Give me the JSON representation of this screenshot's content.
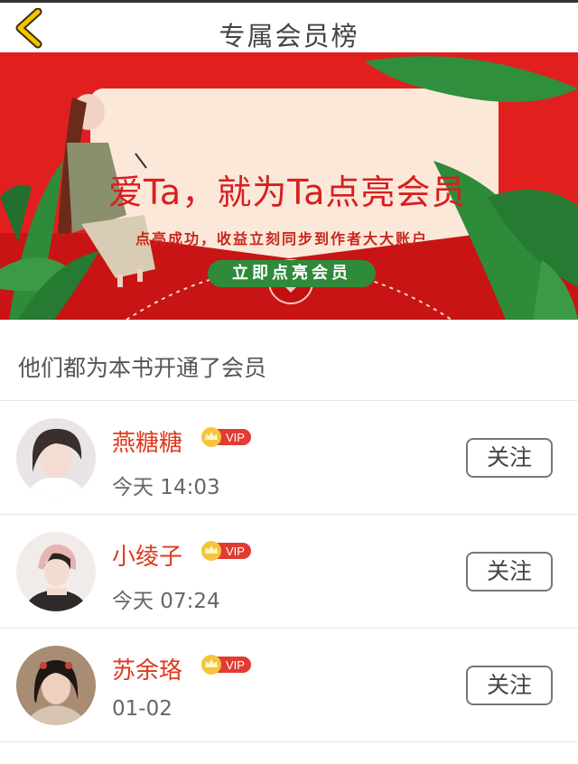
{
  "header": {
    "title": "专属会员榜",
    "back_icon": "chevron-left-icon",
    "accent": "#f5c400"
  },
  "banner": {
    "headline": "爱Ta，就为Ta点亮会员",
    "subtitle": "点亮成功，收益立刻同步到作者大大账户",
    "button_label": "立即点亮会员",
    "colors": {
      "background": "#e21f1f",
      "card": "#fbe8d9",
      "button": "#2f8a3a",
      "leaf": "#2e8b3a"
    }
  },
  "members_section": {
    "heading": "他们都为本书开通了会员"
  },
  "members": [
    {
      "name": "燕糖糖",
      "badge": "VIP",
      "time": "今天 14:03",
      "follow_label": "关注"
    },
    {
      "name": "小绫子",
      "badge": "VIP",
      "time": "今天 07:24",
      "follow_label": "关注"
    },
    {
      "name": "苏余珞",
      "badge": "VIP",
      "time": "01-02",
      "follow_label": "关注"
    }
  ]
}
